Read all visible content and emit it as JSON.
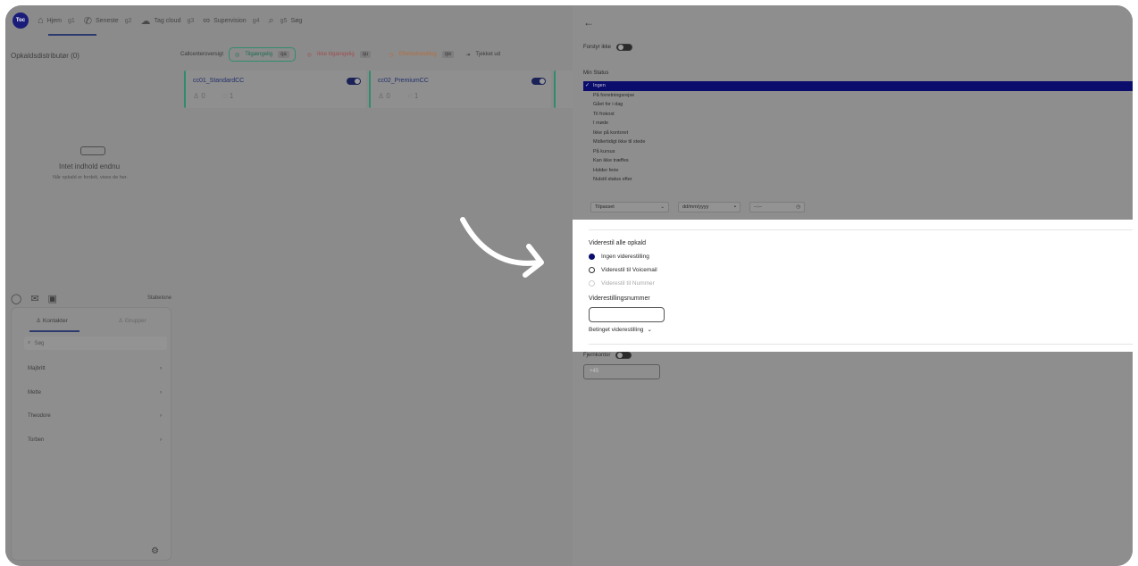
{
  "topbar": {
    "avatar_initials": "Toc",
    "items": [
      {
        "label": "Hjem",
        "key": "g1",
        "icon": "home-icon"
      },
      {
        "label": "Seneste",
        "key": "g2",
        "icon": "phone-icon"
      },
      {
        "label": "Tag cloud",
        "key": "g3",
        "icon": "cloud-icon"
      },
      {
        "label": "Supervision",
        "key": "g4",
        "icon": "binoculars-icon"
      },
      {
        "label": "Søg",
        "key": "g5",
        "icon": "search-icon"
      }
    ]
  },
  "distributor": {
    "title": "Opkaldsdistributør (0)",
    "empty_title": "Intet indhold endnu",
    "empty_sub": "Når opkald er fordelt, vises de her."
  },
  "contacts": {
    "toolbar_label": "Stabelone",
    "tabs": [
      "Kontakter",
      "Grupper"
    ],
    "search_placeholder": "Søg",
    "list": [
      "Majbritt",
      "Mette",
      "Theodore",
      "Torben"
    ]
  },
  "callcenter": {
    "overview_label": "Callcenteroversigt",
    "filters": [
      {
        "label": "Tilgængelig",
        "key": "qa"
      },
      {
        "label": "Ikke tilgængelig",
        "key": "qu"
      },
      {
        "label": "Efterbehandling",
        "key": "qw"
      }
    ],
    "logout_label": "Tjekket ud",
    "cards": [
      {
        "name": "cc01_StandardCC",
        "agents": "0",
        "queue": "1"
      },
      {
        "name": "cc02_PremiumCC",
        "agents": "0",
        "queue": "1"
      }
    ]
  },
  "panel": {
    "back_icon": "arrow-left-icon",
    "dnd_label": "Forstyr ikke",
    "status_label": "Min Status",
    "statuses": [
      "Ingen",
      "På forretningsrejse",
      "Gået for i dag",
      "Til frokost",
      "I møde",
      "Ikke på kontoret",
      "Midlertidigt ikke til stede",
      "På kursus",
      "Kan ikke træffes",
      "Holder ferie",
      "Nulstil status efter"
    ],
    "selected_status": "Ingen",
    "reset": {
      "preset": "Tilpasset",
      "date_placeholder": "dd/mm/yyyy",
      "time_placeholder": "--:--"
    },
    "forward": {
      "title": "Viderestil alle opkald",
      "options": [
        "Ingen viderestilling",
        "Viderestil til Voicemail",
        "Viderestil til Nummer"
      ],
      "selected": "Ingen viderestilling",
      "number_label": "Viderestillingsnummer",
      "number_value": "",
      "conditional_label": "Betinget viderestilling"
    },
    "remote_label": "Fjernkontor",
    "remote_value": "+45"
  }
}
